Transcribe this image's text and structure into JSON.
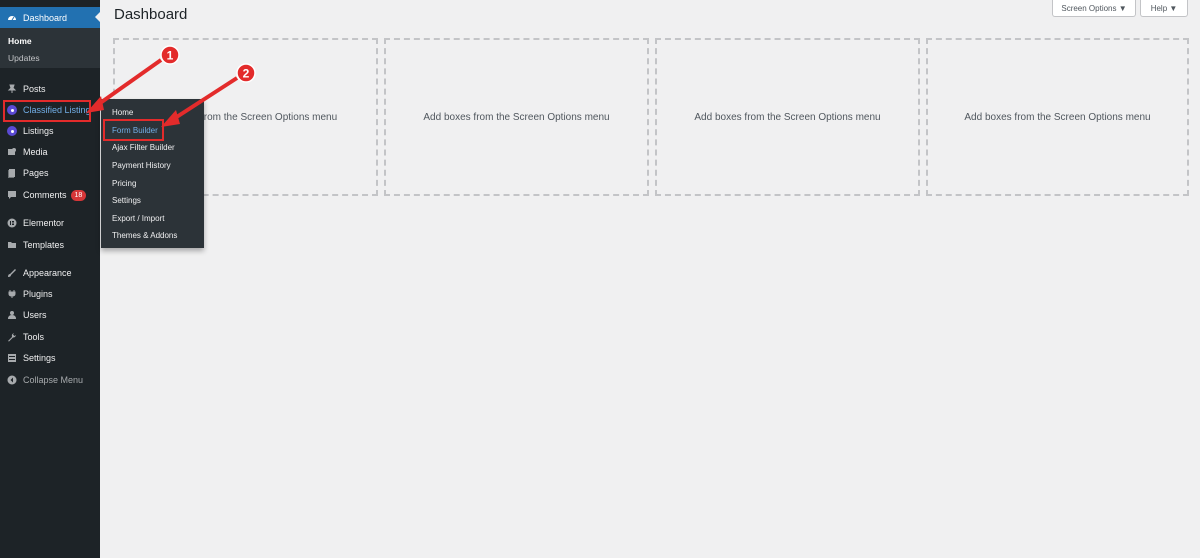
{
  "header": {
    "title": "Dashboard",
    "screen_options": "Screen Options ▼",
    "help": "Help ▼"
  },
  "sidebar": {
    "dashboard": "Dashboard",
    "dashboard_sub": [
      "Home",
      "Updates"
    ],
    "items": [
      {
        "label": "Posts",
        "icon": "pin-icon"
      },
      {
        "label": "Classified Listing",
        "icon": "location-icon"
      },
      {
        "label": "Listings",
        "icon": "location-icon"
      },
      {
        "label": "Media",
        "icon": "media-icon"
      },
      {
        "label": "Pages",
        "icon": "page-icon"
      },
      {
        "label": "Comments",
        "icon": "comment-icon",
        "badge": "18"
      },
      {
        "label": "Elementor",
        "icon": "elementor-icon"
      },
      {
        "label": "Templates",
        "icon": "folder-icon"
      },
      {
        "label": "Appearance",
        "icon": "brush-icon"
      },
      {
        "label": "Plugins",
        "icon": "plug-icon"
      },
      {
        "label": "Users",
        "icon": "user-icon"
      },
      {
        "label": "Tools",
        "icon": "wrench-icon"
      },
      {
        "label": "Settings",
        "icon": "settings-icon"
      },
      {
        "label": "Collapse Menu",
        "icon": "collapse-icon"
      }
    ]
  },
  "flyout": {
    "items": [
      "Home",
      "Form Builder",
      "Ajax Filter Builder",
      "Payment History",
      "Pricing",
      "Settings",
      "Export / Import",
      "Themes & Addons"
    ]
  },
  "boxes": {
    "box1_partial": "from the Screen Options menu",
    "placeholder": "Add boxes from the Screen Options menu"
  },
  "annotations": {
    "step1": "1",
    "step2": "2",
    "color": "#e32b2b"
  },
  "colors": {
    "sidebar_bg": "#1d2327",
    "accent": "#2271b1",
    "highlight_text": "#72aee6"
  }
}
